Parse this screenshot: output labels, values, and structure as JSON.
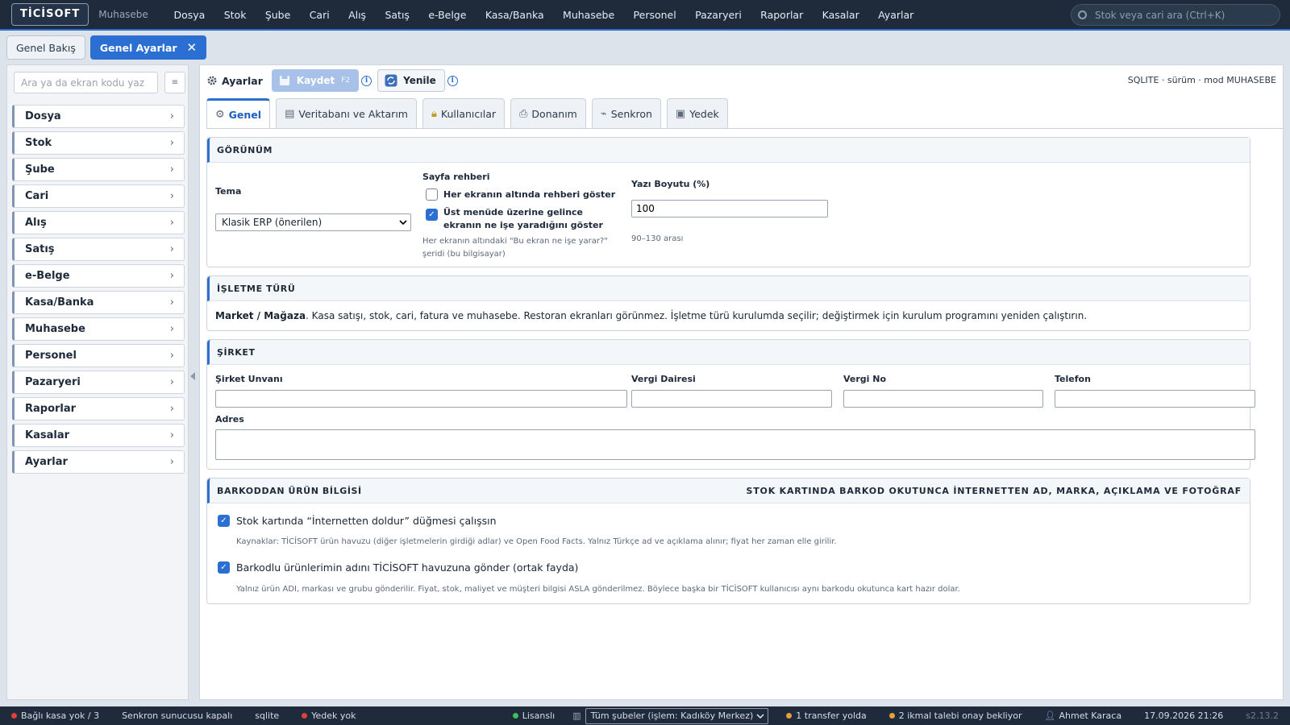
{
  "app": {
    "logo": "TİCİSOFT",
    "module": "Muhasebe"
  },
  "menu": [
    "Dosya",
    "Stok",
    "Şube",
    "Cari",
    "Alış",
    "Satış",
    "e-Belge",
    "Kasa/Banka",
    "Muhasebe",
    "Personel",
    "Pazaryeri",
    "Raporlar",
    "Kasalar",
    "Ayarlar"
  ],
  "search": {
    "placeholder": "Stok veya cari ara (Ctrl+K)"
  },
  "page_tabs": [
    {
      "label": "Genel Bakış"
    },
    {
      "label": "Genel Ayarlar",
      "close": "✕"
    }
  ],
  "sidebar": {
    "search_placeholder": "Ara ya da ekran kodu yaz",
    "grid_icon": "≡",
    "items": [
      "Dosya",
      "Stok",
      "Şube",
      "Cari",
      "Alış",
      "Satış",
      "e-Belge",
      "Kasa/Banka",
      "Muhasebe",
      "Personel",
      "Pazaryeri",
      "Raporlar",
      "Kasalar",
      "Ayarlar"
    ]
  },
  "toolbar": {
    "title": "Ayarlar",
    "save_label": "Kaydet",
    "save_key": "F2",
    "refresh_label": "Yenile",
    "info_glyph": "i",
    "version_info": "SQLITE · sürüm · mod MUHASEBE"
  },
  "settings_tabs": [
    "Genel",
    "Veritabanı ve Aktarım",
    "Kullanıcılar",
    "Donanım",
    "Senkron",
    "Yedek"
  ],
  "gorunum": {
    "title": "GÖRÜNÜM",
    "theme_label": "Tema",
    "theme_value": "Klasik ERP (önerilen)",
    "guide_label": "Sayfa rehberi",
    "guide_opt1": "Her ekranın altında rehberi göster",
    "guide_opt1_checked": false,
    "guide_opt2": "Üst menüde üzerine gelince ekranın ne işe yaradığını göster",
    "guide_opt2_checked": true,
    "guide_hint": "Her ekranın altındaki \"Bu ekran ne işe yarar?\" şeridi (bu bilgisayar)",
    "font_label": "Yazı Boyutu (%)",
    "font_value": "100",
    "font_hint": "90–130 arası"
  },
  "isletme": {
    "title": "İŞLETME TÜRÜ",
    "type_name": "Market / Mağaza",
    "description": ". Kasa satışı, stok, cari, fatura ve muhasebe. Restoran ekranları görünmez. İşletme türü kurulumda seçilir; değiştirmek için kurulum programını yeniden çalıştırın."
  },
  "sirket": {
    "title": "ŞİRKET",
    "fields": {
      "unvan": "Şirket Unvanı",
      "vergi_dairesi": "Vergi Dairesi",
      "vergi_no": "Vergi No",
      "telefon": "Telefon",
      "adres": "Adres"
    },
    "values": {
      "unvan": "",
      "vergi_dairesi": "",
      "vergi_no": "",
      "telefon": "",
      "adres": ""
    }
  },
  "barkod": {
    "title": "BARKODDAN ÜRÜN BİLGİSİ",
    "subtitle": "STOK KARTINDA BARKOD OKUTUNCA İNTERNETTEN AD, MARKA, AÇIKLAMA VE FOTOĞRAF",
    "opt1": "Stok kartında “İnternetten doldur” düğmesi çalışsın",
    "opt1_checked": true,
    "opt1_hint": "Kaynaklar: TİCİSOFT ürün havuzu (diğer işletmelerin girdiği adlar) ve Open Food Facts. Yalnız Türkçe ad ve açıklama alınır; fiyat her zaman elle girilir.",
    "opt2": "Barkodlu ürünlerimin adını TİCİSOFT havuzuna gönder (ortak fayda)",
    "opt2_checked": true,
    "opt2_hint": "Yalnız ürün ADI, markası ve grubu gönderilir. Fiyat, stok, maliyet ve müşteri bilgisi ASLA gönderilmez. Böylece başka bir TİCİSOFT kullanıcısı aynı barkodu okutunca kart hazır dolar."
  },
  "status": {
    "kasa": "Bağlı kasa yok / 3",
    "senkron": "Senkron sunucusu kapalı",
    "db": "sqlite",
    "yedek": "Yedek yok",
    "lisans": "Lisanslı",
    "branch": "Tüm şubeler (işlem: Kadıköy Merkez)",
    "transfer": "1 transfer yolda",
    "ikmal": "2 ikmal talebi onay bekliyor",
    "user": "Ahmet Karaca",
    "datetime": "17.09.2026 21:26",
    "version": "s2.13.2"
  },
  "colors": {
    "accent": "#2c6fd3",
    "topbar": "#1f2a3a",
    "red_dot": "#e0403a",
    "green_dot": "#3fbf5a",
    "orange_dot": "#e8a13a"
  }
}
